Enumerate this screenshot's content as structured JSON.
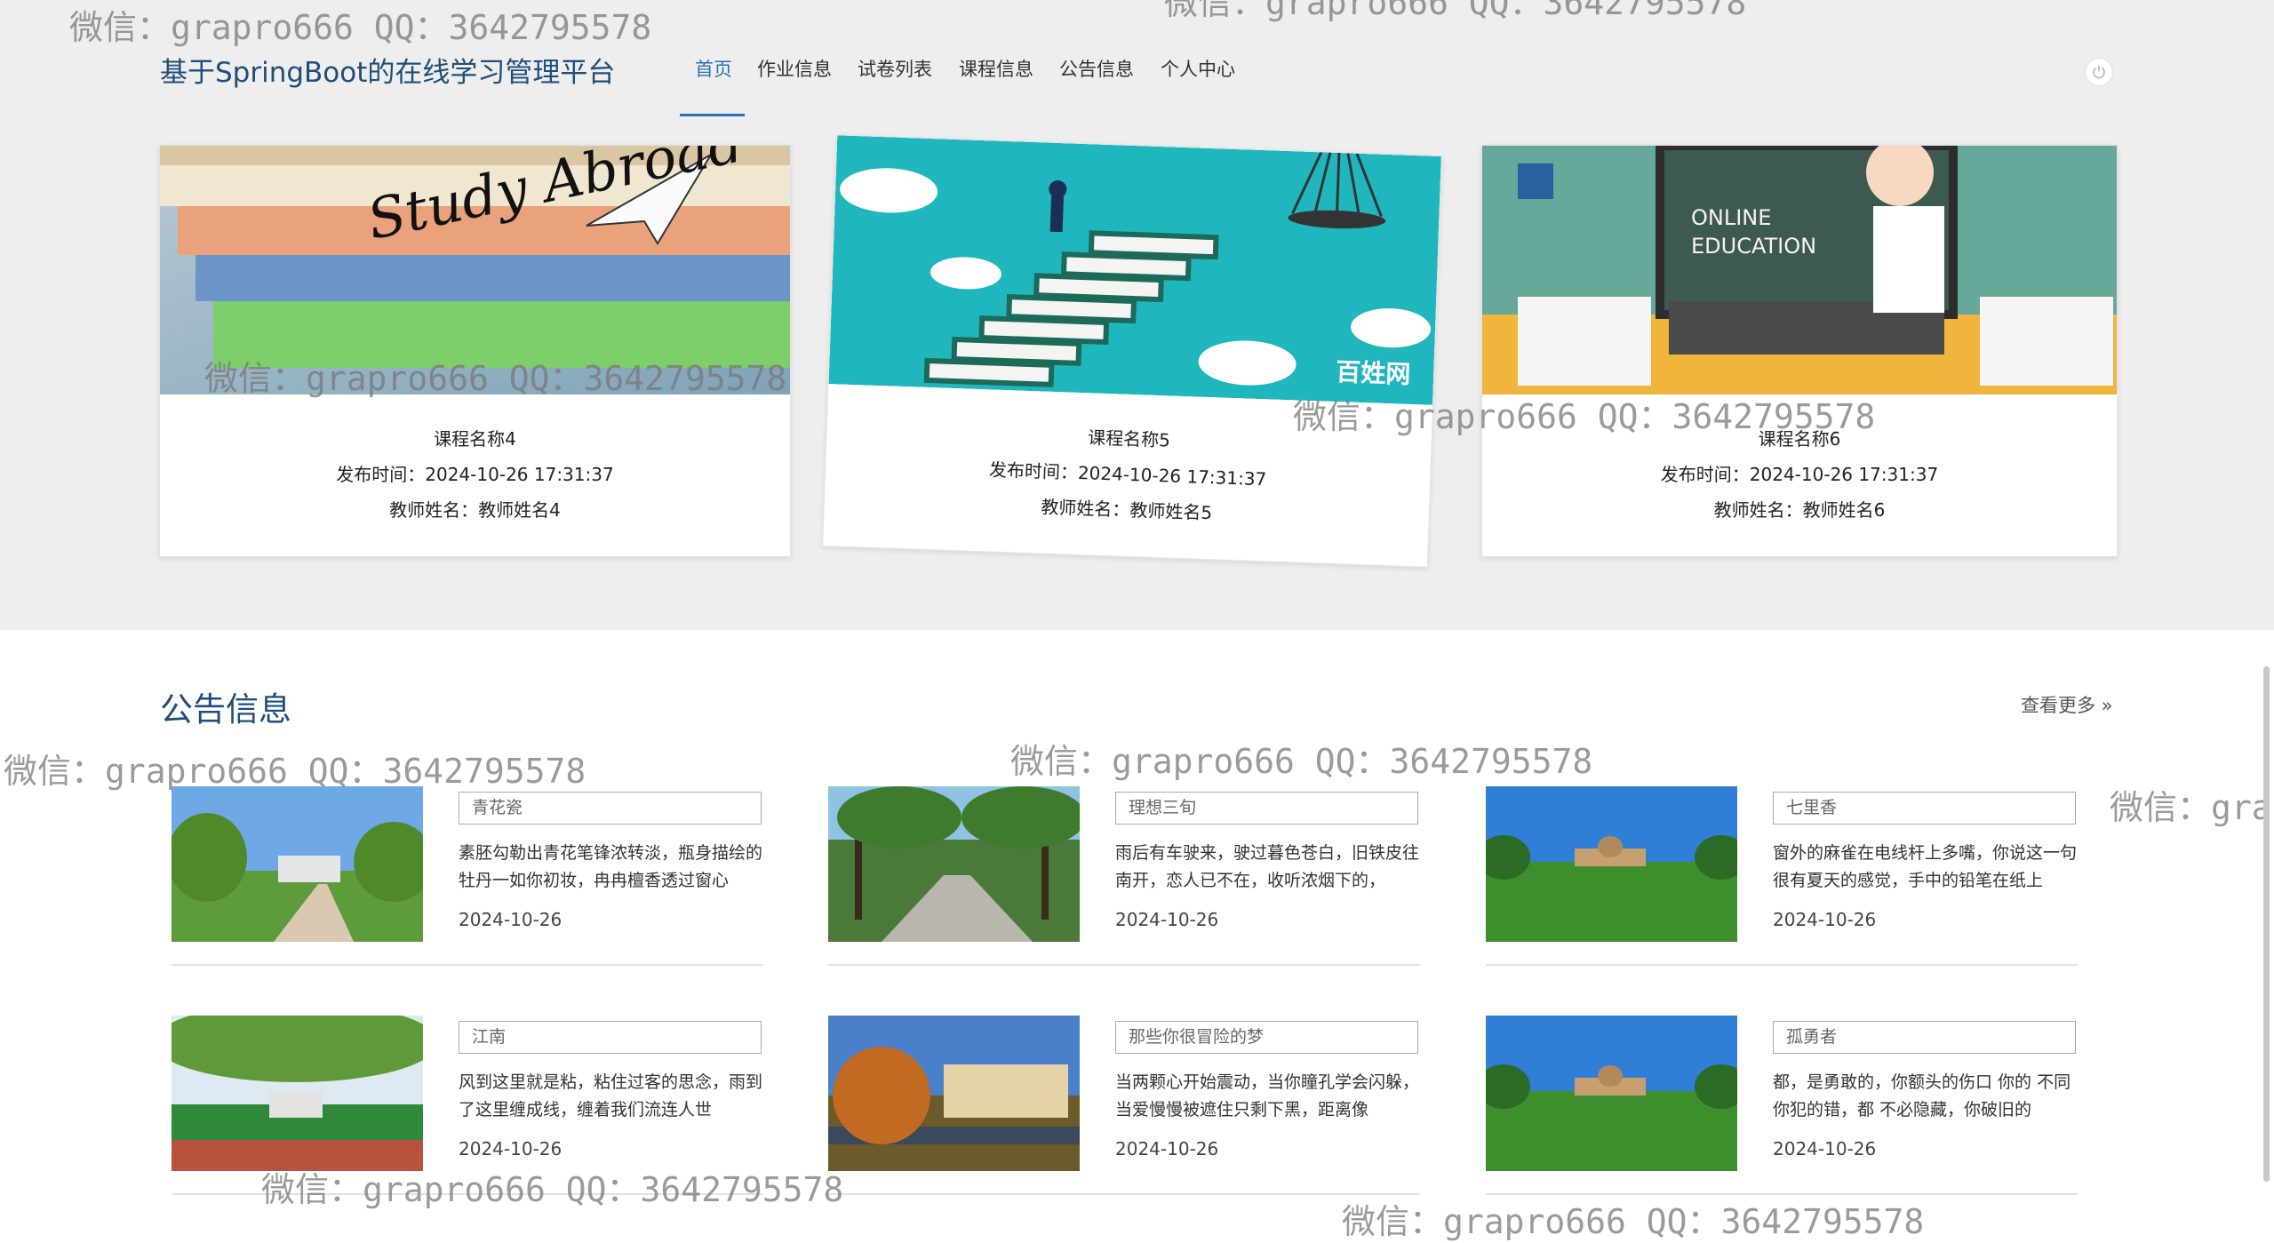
{
  "header": {
    "site_title": "基于SpringBoot的在线学习管理平台",
    "nav": [
      {
        "label": "首页",
        "active": true
      },
      {
        "label": "作业信息"
      },
      {
        "label": "试卷列表"
      },
      {
        "label": "课程信息"
      },
      {
        "label": "公告信息"
      },
      {
        "label": "个人中心"
      }
    ],
    "power_icon": "power-icon"
  },
  "courses": [
    {
      "name": "课程名称4",
      "publish_label": "发布时间：",
      "publish_time": "2024-10-26 17:31:37",
      "teacher_label": "教师姓名：",
      "teacher": "教师姓名4",
      "image_text": "Study Abroad"
    },
    {
      "name": "课程名称5",
      "publish_label": "发布时间：",
      "publish_time": "2024-10-26 17:31:37",
      "teacher_label": "教师姓名：",
      "teacher": "教师姓名5",
      "image_text": "百姓网"
    },
    {
      "name": "课程名称6",
      "publish_label": "发布时间：",
      "publish_time": "2024-10-26 17:31:37",
      "teacher_label": "教师姓名：",
      "teacher": "教师姓名6",
      "image_text": "ONLINE EDUCATION"
    }
  ],
  "notices": {
    "title": "公告信息",
    "more": "查看更多",
    "items": [
      {
        "title": "青花瓷",
        "desc": "素胚勾勒出青花笔锋浓转淡，瓶身描绘的牡丹一如你初妆，冉冉檀香透过窗心",
        "date": "2024-10-26"
      },
      {
        "title": "理想三旬",
        "desc": "雨后有车驶来，驶过暮色苍白，旧铁皮往南开，恋人已不在，收听浓烟下的，",
        "date": "2024-10-26"
      },
      {
        "title": "七里香",
        "desc": "窗外的麻雀在电线杆上多嘴，你说这一句很有夏天的感觉，手中的铅笔在纸上",
        "date": "2024-10-26"
      },
      {
        "title": "江南",
        "desc": "风到这里就是粘，粘住过客的思念，雨到了这里缠成线，缠着我们流连人世",
        "date": "2024-10-26"
      },
      {
        "title": "那些你很冒险的梦",
        "desc": "当两颗心开始震动，当你瞳孔学会闪躲，当爱慢慢被遮住只剩下黑，距离像",
        "date": "2024-10-26"
      },
      {
        "title": "孤勇者",
        "desc": "都，是勇敢的，你额头的伤口 你的 不同 你犯的错，都 不必隐藏，你破旧的",
        "date": "2024-10-26"
      }
    ]
  },
  "watermark": "微信：grapro666 QQ：3642795578"
}
